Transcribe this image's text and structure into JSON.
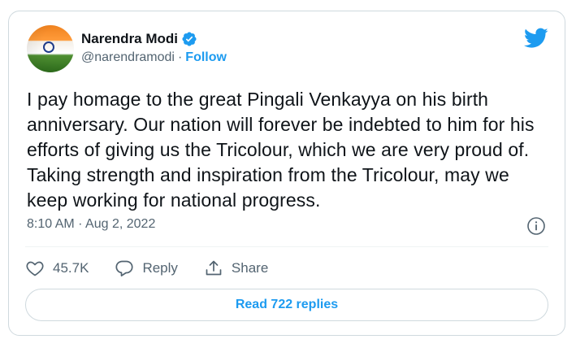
{
  "author": {
    "display_name": "Narendra Modi",
    "handle": "@narendramodi",
    "separator": "·",
    "follow_label": "Follow"
  },
  "tweet": {
    "text": "I pay homage to the great Pingali Venkayya on his birth anniversary. Our nation will forever be indebted to him for his efforts of giving us the Tricolour, which we are very proud of. Taking strength and inspiration from the Tricolour, may we keep working for national progress.",
    "timestamp": "8:10 AM · Aug 2, 2022"
  },
  "actions": {
    "like_count": "45.7K",
    "reply_label": "Reply",
    "share_label": "Share"
  },
  "read_replies_label": "Read 722 replies",
  "colors": {
    "accent": "#1d9bf0",
    "text": "#0f1419",
    "muted": "#536471",
    "border": "#cfd9de"
  },
  "icons": [
    "verified-badge-icon",
    "twitter-bird-icon",
    "info-icon",
    "heart-icon",
    "reply-icon",
    "share-icon"
  ]
}
